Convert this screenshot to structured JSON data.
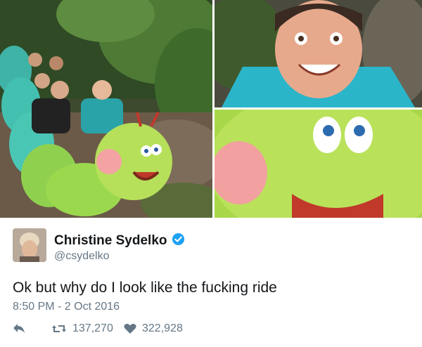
{
  "tweet": {
    "display_name": "Christine Sydelko",
    "handle": "@csydelko",
    "text": "Ok but why do I look like the fucking ride",
    "timestamp": "8:50 PM - 2 Oct 2016",
    "retweets": "137,270",
    "likes": "322,928"
  },
  "colors": {
    "text": "#14171a",
    "secondary": "#657786",
    "verified": "#1da1f2"
  },
  "icons": [
    "reply-icon",
    "retweet-icon",
    "heart-icon",
    "verified-badge-icon"
  ]
}
